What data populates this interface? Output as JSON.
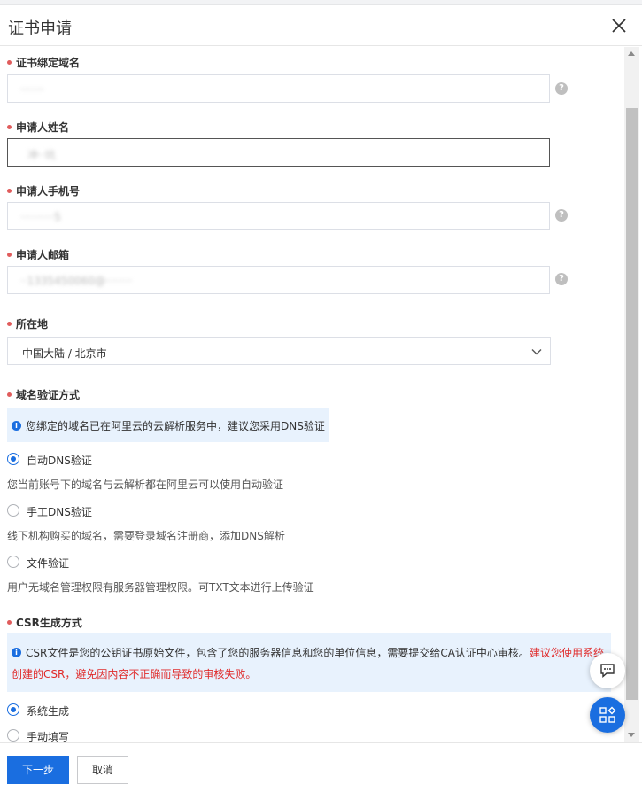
{
  "dialog": {
    "title": "证书申请",
    "close_icon": "close-icon"
  },
  "fields": {
    "domain": {
      "label": "证书绑定域名",
      "value": "·······"
    },
    "name": {
      "label": "申请人姓名",
      "value": "冲··坑"
    },
    "phone": {
      "label": "申请人手机号",
      "value": "··········5"
    },
    "email": {
      "label": "申请人邮箱",
      "value": "··1335450060@········"
    },
    "location": {
      "label": "所在地",
      "value": "中国大陆 / 北京市"
    }
  },
  "verification": {
    "label": "域名验证方式",
    "notice": "您绑定的域名已在阿里云的云解析服务中，建议您采用DNS验证",
    "options": [
      {
        "label": "自动DNS验证",
        "desc": "您当前账号下的域名与云解析都在阿里云可以使用自动验证",
        "checked": true
      },
      {
        "label": "手工DNS验证",
        "desc": "线下机构购买的域名，需要登录域名注册商，添加DNS解析",
        "checked": false
      },
      {
        "label": "文件验证",
        "desc": "用户无域名管理权限有服务器管理权限。可TXT文本进行上传验证",
        "checked": false
      }
    ]
  },
  "csr": {
    "label": "CSR生成方式",
    "notice_main": "CSR文件是您的公钥证书原始文件，包含了您的服务器信息和您的单位信息，需要提交给CA认证中心审核。",
    "notice_warn_1": "建议您使用系统",
    "notice_warn_2": "创建的CSR，避免因内容不正确而导致的审核失败。",
    "options": [
      {
        "label": "系统生成",
        "checked": true
      },
      {
        "label": "手动填写",
        "checked": false
      }
    ]
  },
  "footer": {
    "next_label": "下一步",
    "cancel_label": "取消"
  },
  "colors": {
    "primary": "#1a6ee0",
    "required_dot": "#e05c5c",
    "warn_text": "#e02b2b",
    "notice_bg": "#e8f2fd"
  }
}
